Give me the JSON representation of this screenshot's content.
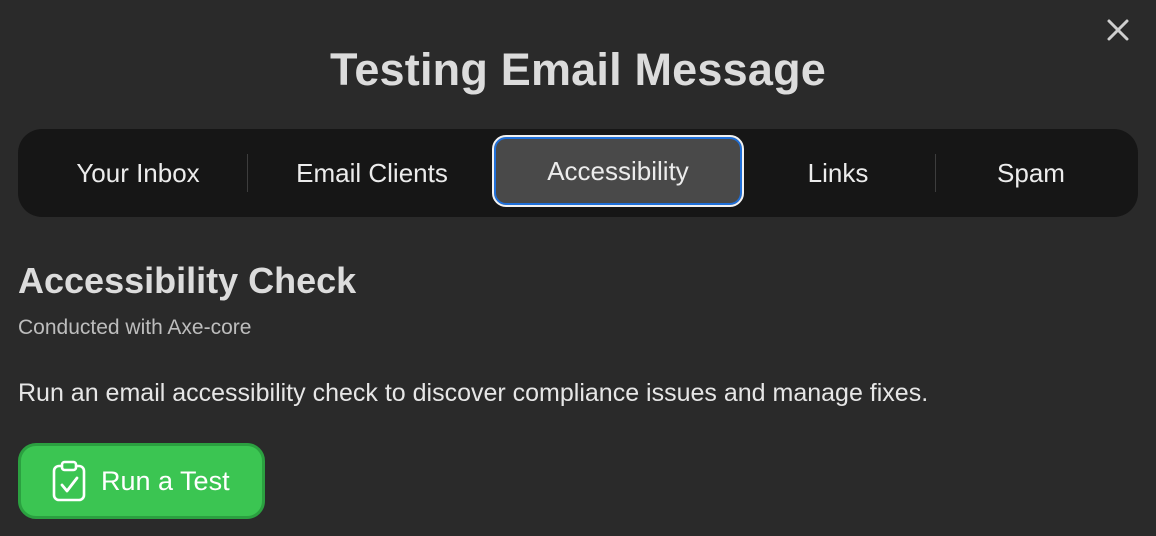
{
  "dialog": {
    "title": "Testing Email Message",
    "close_icon": "close-icon"
  },
  "tabs": [
    {
      "label": "Your Inbox",
      "active": false
    },
    {
      "label": "Email Clients",
      "active": false
    },
    {
      "label": "Accessibility",
      "active": true
    },
    {
      "label": "Links",
      "active": false
    },
    {
      "label": "Spam",
      "active": false
    }
  ],
  "section": {
    "title": "Accessibility Check",
    "subtitle": "Conducted with Axe-core",
    "description": "Run an email accessibility check to discover compliance issues and manage fixes."
  },
  "run_button": {
    "label": "Run a Test",
    "icon": "clipboard-check-icon"
  },
  "colors": {
    "background": "#2a2a2a",
    "tabbar": "#161616",
    "active_tab": "#494949",
    "focus_ring": "#1f6fd8",
    "primary_button": "#3bc552"
  }
}
